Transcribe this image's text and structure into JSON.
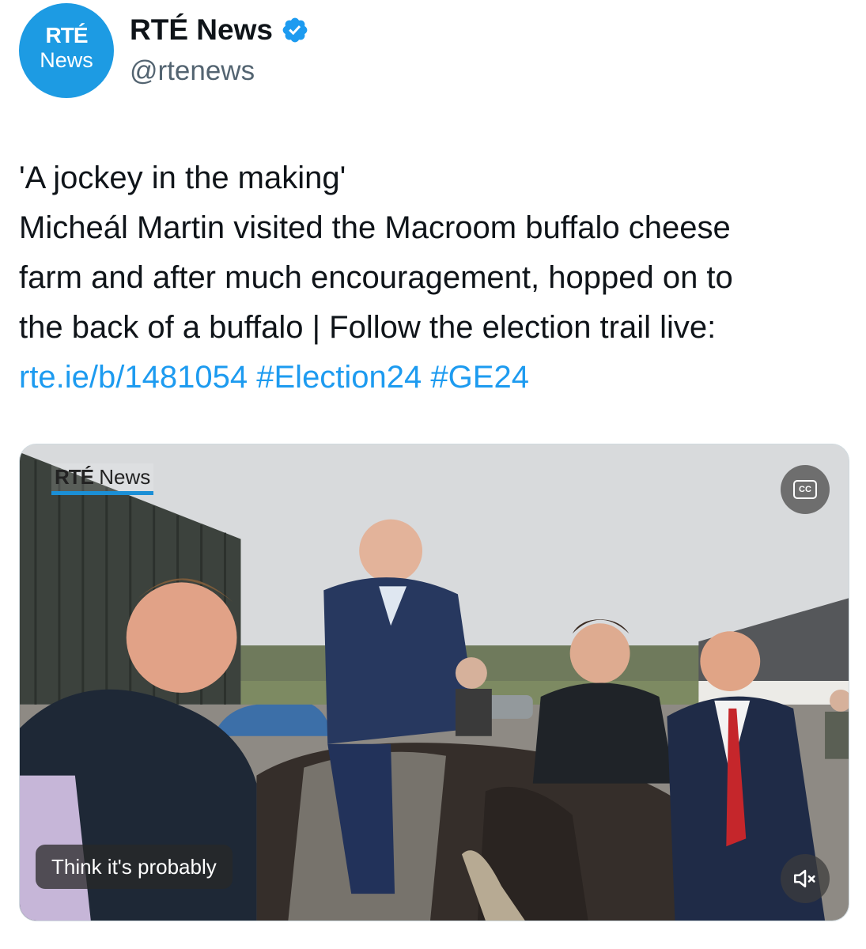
{
  "account": {
    "avatar_text_line1": "RTÉ",
    "avatar_text_line2": "News",
    "display_name": "RTÉ News",
    "handle": "@rtenews",
    "verified": true,
    "avatar_color": "#1d9be3",
    "verified_color": "#1d9bf0"
  },
  "tweet": {
    "lines": [
      "'A jockey in the making'",
      "Micheál Martin visited the Macroom buffalo cheese",
      "farm and after much encouragement, hopped on to",
      "the back of a buffalo | Follow the election trail live:"
    ],
    "link": "rte.ie/b/1481054",
    "hashtags": [
      "#Election24",
      "#GE24"
    ],
    "link_color": "#1d9bf0"
  },
  "video": {
    "watermark_bold": "RTÉ",
    "watermark_light": "News",
    "caption": "Think it's probably",
    "cc_label": "CC",
    "cc_icon": "closed-captions-icon",
    "mute_icon": "speaker-muted-icon"
  }
}
